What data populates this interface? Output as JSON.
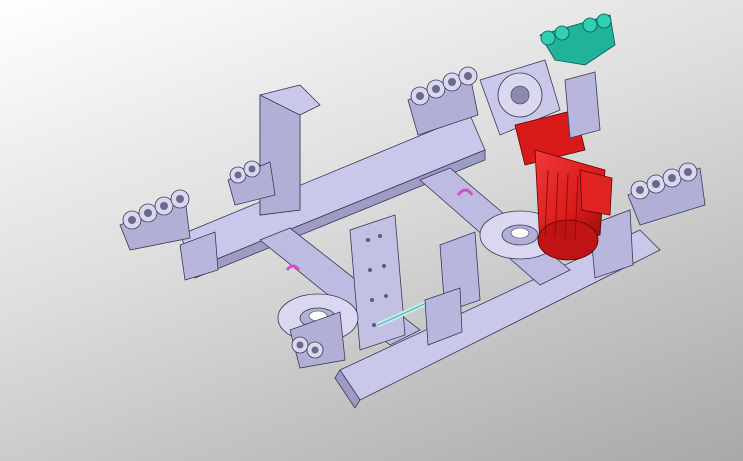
{
  "viewport": {
    "background_top": "#ffffff",
    "background_bottom": "#a8a8a8"
  },
  "model": {
    "frame_color": "#c9c8e8",
    "frame_shadow": "#9d9cc4",
    "frame_edge": "#3a3a5a",
    "motor_color": "#d91a1a",
    "motor_dark": "#8e0c0c",
    "bracket_color": "#1fb39a",
    "shaft_color": "#b8f0f0",
    "clip_color": "#d050d0",
    "icons": [
      "roller-assembly-icon",
      "motor-icon",
      "pulley-icon",
      "bracket-icon"
    ]
  }
}
